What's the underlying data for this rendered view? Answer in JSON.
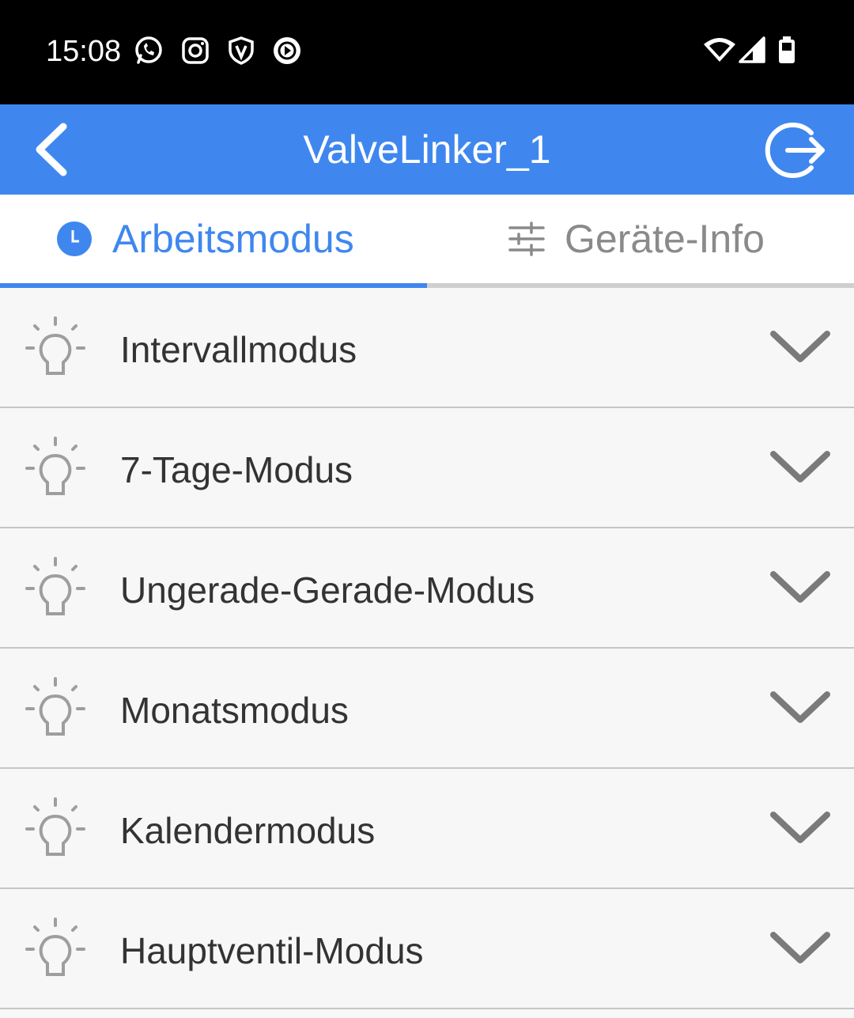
{
  "status_bar": {
    "time": "15:08",
    "notification_icons": [
      "whatsapp-icon",
      "instagram-icon",
      "shield-icon",
      "play-icon"
    ],
    "system_icons": [
      "wifi-icon",
      "signal-icon",
      "battery-icon"
    ]
  },
  "app_bar": {
    "title": "ValveLinker_1",
    "back_icon": "chevron-left-icon",
    "exit_icon": "logout-icon",
    "background_color": "#3f87ef"
  },
  "tabs": [
    {
      "label": "Arbeitsmodus",
      "icon": "clock-icon",
      "active": true
    },
    {
      "label": "Geräte-Info",
      "icon": "sliders-icon",
      "active": false
    }
  ],
  "modes": [
    {
      "label": "Intervallmodus",
      "icon": "lightbulb-icon"
    },
    {
      "label": "7-Tage-Modus",
      "icon": "lightbulb-icon"
    },
    {
      "label": "Ungerade-Gerade-Modus",
      "icon": "lightbulb-icon"
    },
    {
      "label": "Monatsmodus",
      "icon": "lightbulb-icon"
    },
    {
      "label": "Kalendermodus",
      "icon": "lightbulb-icon"
    },
    {
      "label": "Hauptventil-Modus",
      "icon": "lightbulb-icon"
    }
  ],
  "colors": {
    "accent": "#3f87ef",
    "inactive_tab": "#8a8a8a",
    "list_background": "#f7f7f7",
    "icon_gray": "#9e9e9e"
  }
}
